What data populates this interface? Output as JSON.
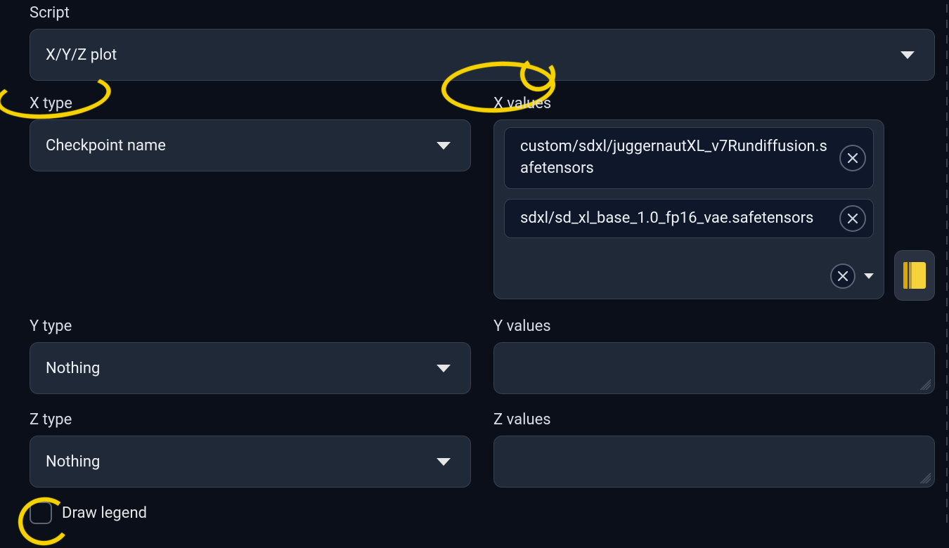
{
  "labels": {
    "script": "Script",
    "x_type": "X type",
    "x_values": "X values",
    "y_type": "Y type",
    "y_values": "Y values",
    "z_type": "Z type",
    "z_values": "Z values",
    "draw_legend": "Draw legend"
  },
  "script_select": {
    "value": "X/Y/Z plot"
  },
  "x_type_select": {
    "value": "Checkpoint name"
  },
  "x_values_tokens": {
    "0": {
      "text": "custom/sdxl/juggernautXL_v7Rundiffusion.safetensors"
    },
    "1": {
      "text": "sdxl/sd_xl_base_1.0_fp16_vae.safetensors"
    }
  },
  "y_type_select": {
    "value": "Nothing"
  },
  "y_values": {
    "text": ""
  },
  "z_type_select": {
    "value": "Nothing"
  },
  "z_values": {
    "text": ""
  },
  "draw_legend_checked": false,
  "icons": {
    "caret": "chevron-down-icon",
    "close": "close-icon",
    "book": "book-icon"
  },
  "annotation_highlights": [
    "x_type_label",
    "x_values_label",
    "draw_legend_checkbox"
  ]
}
